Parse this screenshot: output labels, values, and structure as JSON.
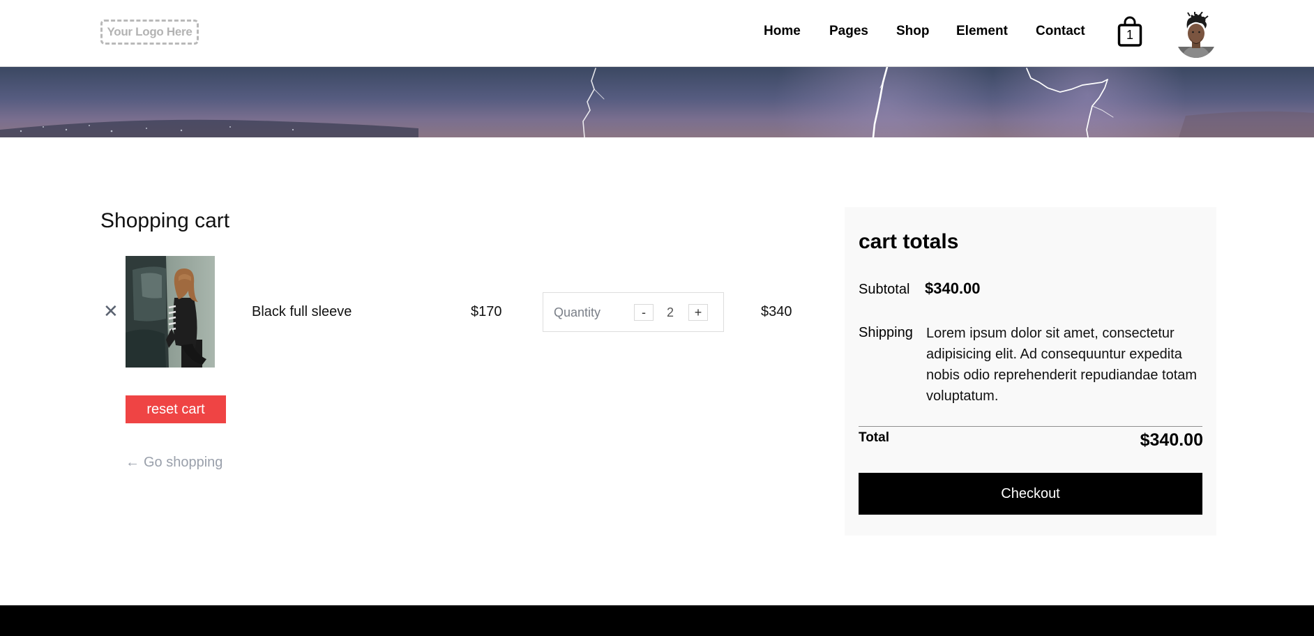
{
  "header": {
    "logo_text": "Your Logo Here",
    "nav": {
      "home": "Home",
      "pages": "Pages",
      "shop": "Shop",
      "element": "Element",
      "contact": "Contact"
    },
    "bag_count": "1",
    "icons": {
      "bag": "shopping-bag-icon",
      "avatar": "user-avatar"
    }
  },
  "cart": {
    "title": "Shopping cart",
    "remove_glyph": "✕",
    "item": {
      "name": "Black full sleeve",
      "price": "$170",
      "quantity_label": "Quantity",
      "quantity": "2",
      "minus": "-",
      "plus": "+",
      "line_total": "$340"
    },
    "reset_label": "reset cart",
    "go_shopping": "Go shopping",
    "go_shopping_arrow": "←"
  },
  "totals": {
    "title": "cart totals",
    "subtotal_label": "Subtotal",
    "subtotal_value": "$340.00",
    "shipping_label": "Shipping",
    "shipping_text": "Lorem ipsum dolor sit amet, consectetur adipisicing elit. Ad consequuntur expedita nobis odio reprehenderit repudiandae totam voluptatum.",
    "total_label": "Total",
    "total_value": "$340.00",
    "checkout_label": "Checkout"
  },
  "colors": {
    "accent_red": "#ef4444",
    "checkout_bg": "#000000",
    "panel_bg": "#f9f9f9",
    "muted_text": "#9aa0ab"
  }
}
